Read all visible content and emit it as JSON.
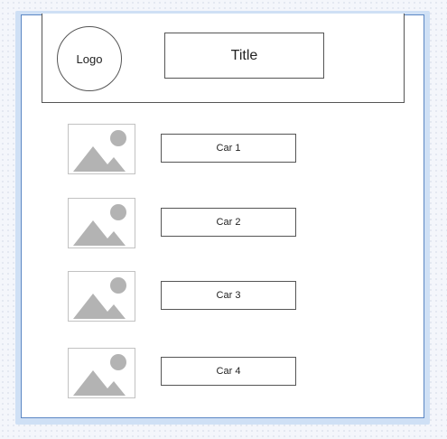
{
  "header": {
    "logo_label": "Logo",
    "title": "Title"
  },
  "cars": [
    {
      "label": "Car 1",
      "image_icon": "image-placeholder-icon"
    },
    {
      "label": "Car 2",
      "image_icon": "image-placeholder-icon"
    },
    {
      "label": "Car 3",
      "image_icon": "image-placeholder-icon"
    },
    {
      "label": "Car 4",
      "image_icon": "image-placeholder-icon"
    }
  ],
  "colors": {
    "outline": "#555555",
    "placeholder_gray": "#b3b3b3",
    "selection_border": "#5b87c4",
    "selection_fill": "#cfe0f5"
  }
}
